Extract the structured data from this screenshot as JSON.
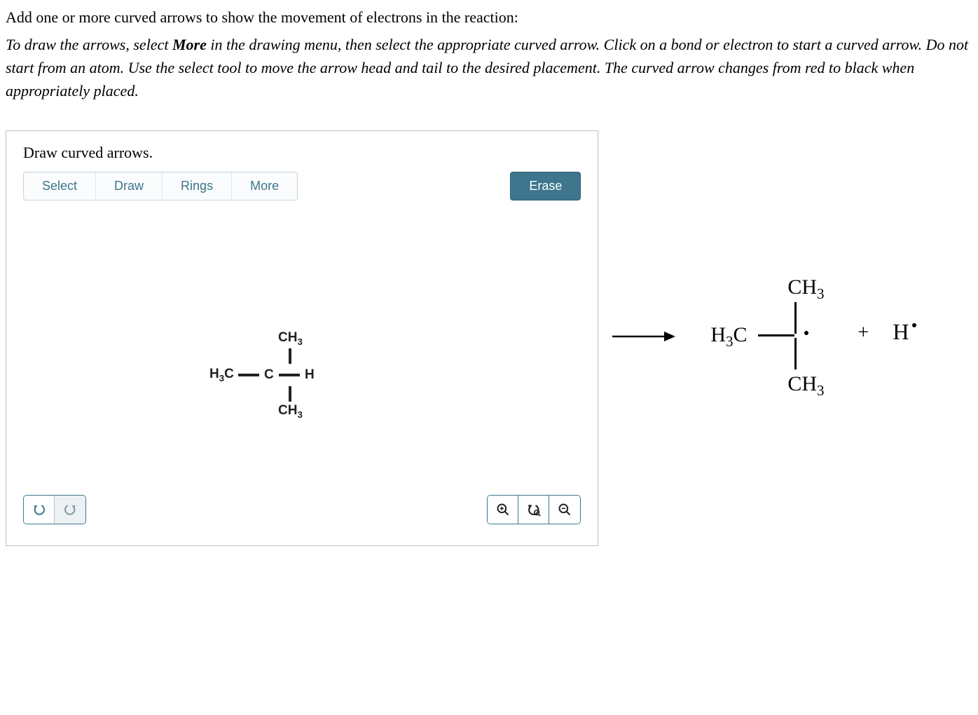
{
  "question": "Add one or more curved arrows to show the movement of electrons in the reaction:",
  "instruction_parts": {
    "p1": "To draw the arrows, select ",
    "bold": "More",
    "p2": " in the drawing menu, then select the appropriate curved arrow. Click on a bond or electron to start a curved arrow. Do not start from an atom. Use the select tool to move the arrow head and tail to the desired placement. The curved arrow changes from red to black when appropriately placed."
  },
  "editor": {
    "title": "Draw curved arrows.",
    "tabs": [
      "Select",
      "Draw",
      "Rings",
      "More"
    ],
    "erase": "Erase"
  },
  "reactant": {
    "top": "CH",
    "top_sub": "3",
    "left": "H",
    "left_sub": "3",
    "left2": "C",
    "center": "C",
    "right": "H",
    "bottom": "CH",
    "bottom_sub": "3"
  },
  "product": {
    "top": "CH",
    "top_sub": "3",
    "left": "H",
    "left_sub": "3",
    "left2": "C",
    "bottom": "CH",
    "bottom_sub": "3",
    "plus": "+",
    "h": "H"
  }
}
